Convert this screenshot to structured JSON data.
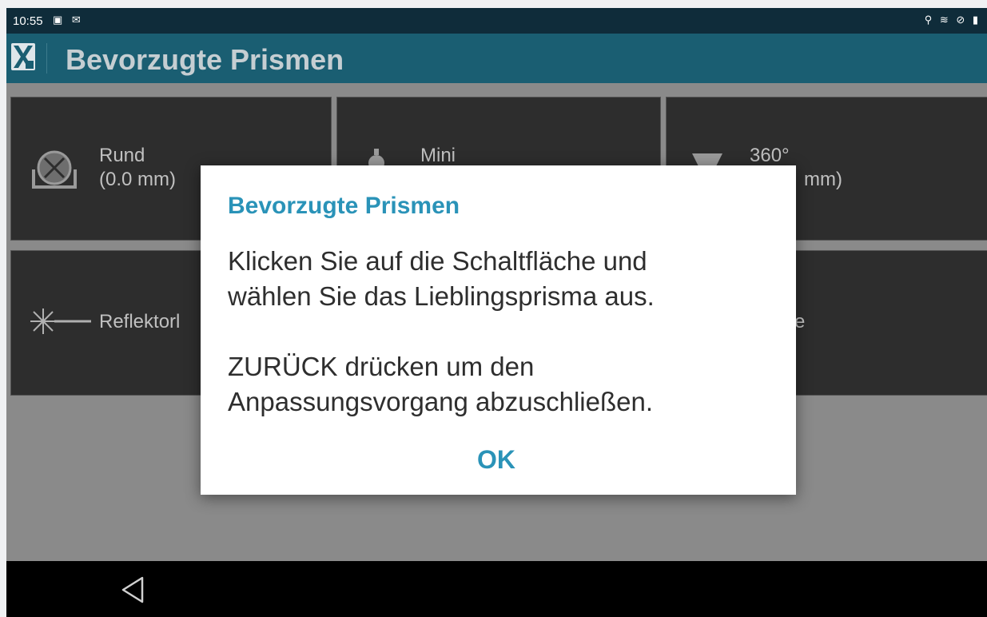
{
  "statusbar": {
    "time": "10:55",
    "left_icons": [
      "image-icon",
      "mail-icon"
    ],
    "right_icons": [
      "location-icon",
      "wifi-icon",
      "blocked-icon",
      "battery-icon"
    ],
    "left_glyphs": "▣ ✉",
    "right_glyphs": "⚲ ≋ ⊘ ▮"
  },
  "appbar": {
    "title": "Bevorzugte Prismen"
  },
  "tiles": [
    {
      "label": "Rund",
      "sub": "(0.0 mm)",
      "icon": "round-prism-icon"
    },
    {
      "label": "Mini",
      "sub": "",
      "icon": "mini-prism-icon"
    },
    {
      "label": "360°",
      "sub": "mm)",
      "icon": "prism-360-icon"
    },
    {
      "label": "Reflektorl",
      "sub": "",
      "icon": "reflectorless-icon"
    },
    {
      "label": "",
      "sub": "",
      "icon": ""
    },
    {
      "label": "e",
      "sub": "",
      "icon": ""
    }
  ],
  "dialog": {
    "title": "Bevorzugte Prismen",
    "line1": "Klicken Sie auf die Schaltfläche und",
    "line2": "wählen Sie das Lieblingsprisma aus.",
    "line3": "ZURÜCK drücken um den",
    "line4": "Anpassungsvorgang abzuschließen.",
    "ok_label": "OK"
  },
  "navbar": {
    "back_icon": "back-triangle-icon"
  },
  "colors": {
    "statusbar": "#0f2c3a",
    "appbar": "#1a5e72",
    "accent": "#2a93b8",
    "tile": "#2d2d2d",
    "scrim": "#8a8a8a"
  }
}
